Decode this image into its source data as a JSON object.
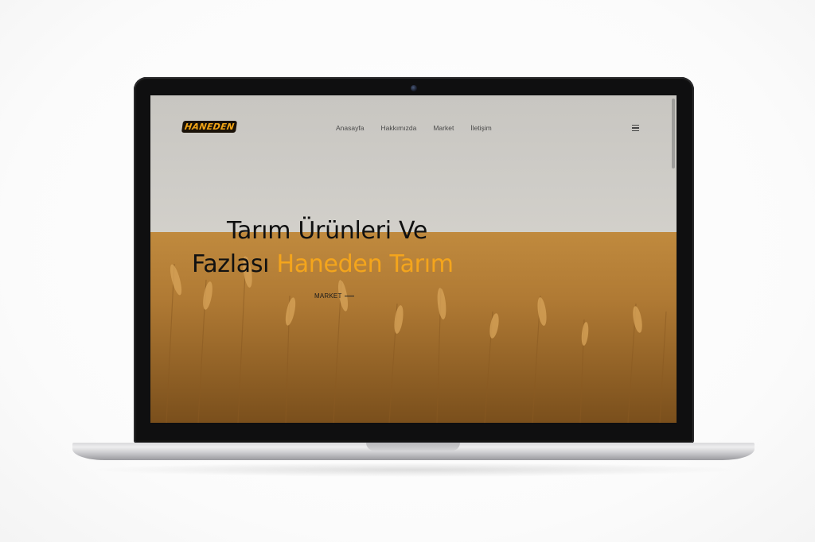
{
  "site": {
    "logo_text": "HANEDEN",
    "nav": {
      "items": [
        {
          "label": "Anasayfa"
        },
        {
          "label": "Hakkımızda"
        },
        {
          "label": "Market"
        },
        {
          "label": "İletişim"
        }
      ],
      "menu_icon": "hamburger-menu-icon"
    },
    "hero": {
      "title_line1": "Tarım Ürünleri Ve",
      "title_line2_prefix": "Fazlası ",
      "title_line2_accent": "Haneden Tarım",
      "cta_label": "MARKET",
      "cta_icon": "arrow-right-icon"
    }
  },
  "colors": {
    "accent": "#f4a51c",
    "text_dark": "#111111",
    "nav_text": "#4a4a4a",
    "device_bezel": "#0f0f10"
  }
}
